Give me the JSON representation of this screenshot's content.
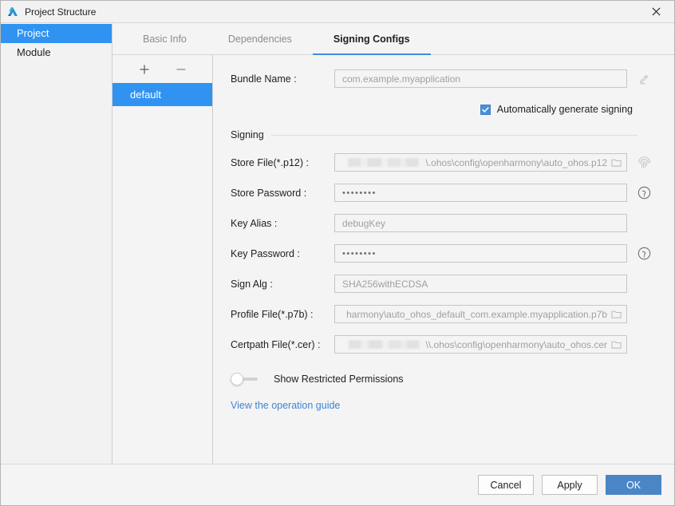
{
  "window": {
    "title": "Project Structure",
    "app_icon": "deveco-logo-icon",
    "close_icon": "close-icon"
  },
  "sidebar": {
    "items": [
      {
        "label": "Project",
        "selected": true
      },
      {
        "label": "Module",
        "selected": false
      }
    ]
  },
  "tabs": [
    {
      "label": "Basic Info",
      "active": false
    },
    {
      "label": "Dependencies",
      "active": false
    },
    {
      "label": "Signing Configs",
      "active": true
    }
  ],
  "config_list": {
    "add_label": "+",
    "remove_label": "−",
    "entries": [
      {
        "label": "default",
        "selected": true
      }
    ]
  },
  "form": {
    "bundle_name": {
      "label": "Bundle Name :",
      "value": "com.example.myapplication",
      "edit_icon": "pencil-icon"
    },
    "auto_generate": {
      "label": "Automatically generate signing",
      "checked": true
    },
    "signing_section_title": "Signing",
    "store_file": {
      "label": "Store File(*.p12) :",
      "value": "\\.ohos\\config\\openharmony\\auto_ohos.p12",
      "redacted": true,
      "browse_icon": "folder-icon",
      "trailing_icon": "fingerprint-icon"
    },
    "store_password": {
      "label": "Store Password :",
      "value": "••••••••",
      "help_icon": "help-circle-icon"
    },
    "key_alias": {
      "label": "Key Alias :",
      "value": "debugKey"
    },
    "key_password": {
      "label": "Key Password :",
      "value": "••••••••",
      "help_icon": "help-circle-icon"
    },
    "sign_alg": {
      "label": "Sign Alg :",
      "value": "SHA256withECDSA"
    },
    "profile_file": {
      "label": "Profile File(*.p7b) :",
      "value": "harmony\\auto_ohos_default_com.example.myapplication.p7b",
      "browse_icon": "folder-icon"
    },
    "certpath_file": {
      "label": "Certpath File(*.cer) :",
      "value": "\\\\.ohos\\config\\openharmony\\auto_ohos.cer",
      "redacted": true,
      "browse_icon": "folder-icon"
    },
    "show_restricted": {
      "label": "Show Restricted Permissions",
      "enabled": false
    },
    "guide_link": "View the operation guide"
  },
  "footer": {
    "cancel": "Cancel",
    "apply": "Apply",
    "ok": "OK"
  },
  "colors": {
    "accent_selection": "#3093f2",
    "tab_underline": "#3c8ede",
    "checkbox": "#4a90d9",
    "primary_button": "#4a86c5",
    "link": "#3f84d4"
  }
}
